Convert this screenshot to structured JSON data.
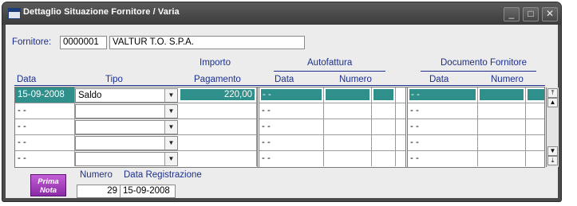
{
  "window": {
    "title": "Dettaglio Situazione Fornitore / Varia",
    "controls": {
      "minimize": "_",
      "maximize": "□",
      "close": "✕"
    }
  },
  "fornitore": {
    "label": "Fornitore:",
    "code": "0000001",
    "name": "VALTUR T.O. S.P.A."
  },
  "headers": {
    "data": "Data",
    "tipo": "Tipo",
    "importo_top": "Importo",
    "importo_bottom": "Pagamento",
    "autofattura": "Autofattura",
    "autofattura_data": "Data",
    "autofattura_numero": "Numero",
    "doc_fornitore": "Documento Fornitore",
    "doc_data": "Data",
    "doc_numero": "Numero"
  },
  "rows": [
    {
      "data": "15-09-2008",
      "tipo": "Saldo",
      "importo": "220,00",
      "af_data": "- -",
      "doc_data": "- -"
    },
    {
      "data": "- -",
      "tipo": "",
      "importo": "",
      "af_data": "- -",
      "doc_data": "- -"
    },
    {
      "data": "- -",
      "tipo": "",
      "importo": "",
      "af_data": "- -",
      "doc_data": "- -"
    },
    {
      "data": "- -",
      "tipo": "",
      "importo": "",
      "af_data": "- -",
      "doc_data": "- -"
    },
    {
      "data": "- -",
      "tipo": "",
      "importo": "",
      "af_data": "- -",
      "doc_data": "- -"
    }
  ],
  "footer": {
    "prima_nota_line1": "Prima",
    "prima_nota_line2": "Nota",
    "numero_label": "Numero",
    "data_reg_label": "Data Registrazione",
    "numero_value": "29",
    "data_reg_value": "15-09-2008"
  },
  "colors": {
    "selected_row": "#2f8f8b",
    "label_blue": "#1c2f8c",
    "prima_nota": "#a63fbf"
  }
}
